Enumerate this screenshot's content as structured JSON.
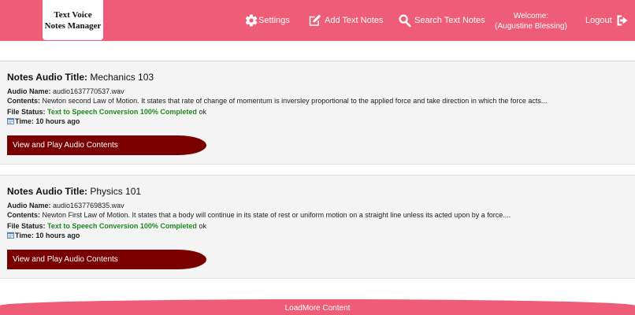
{
  "header": {
    "logo_line1": "Text Voice",
    "logo_line2": "Notes Manager",
    "nav": {
      "settings": "Settings",
      "add": "Add Text Notes",
      "search": "Search Text Notes",
      "logout": "Logout"
    },
    "welcome_line1": "Welcome:",
    "welcome_line2": "(Augustine Blessing)"
  },
  "labels": {
    "title": "Notes Audio Title:",
    "audio_name": "Audio Name:",
    "contents": "Contents:",
    "file_status": "File Status:",
    "time": "Time:",
    "play_button": "View and Play Audio Contents"
  },
  "notes": [
    {
      "title": "Mechanics 103",
      "audio_name": "audio1637770537.wav",
      "contents": "Newton second Law of Motion. It states that rate of change of momentum is inversley proportional to the applied force and take direction in which the force acts...",
      "status_green": "Text to Speech Conversion 100% Completed",
      "status_extra": "ok",
      "time": "10 hours ago"
    },
    {
      "title": "Physics 101",
      "audio_name": "audio1637769835.wav",
      "contents": "Newton First Law of Motion. It states that a body will continue in its state of rest or uniform motion on a straight line unless its acted upon by a force....",
      "status_green": "Text to Speech Conversion 100% Completed",
      "status_extra": "ok",
      "time": "10 hours ago"
    }
  ],
  "footer": {
    "loadmore": "LoadMore Content"
  },
  "colors": {
    "header_bg": "#ee5c78",
    "button_bg": "#7a0000",
    "status_green": "#1f8a1f"
  }
}
